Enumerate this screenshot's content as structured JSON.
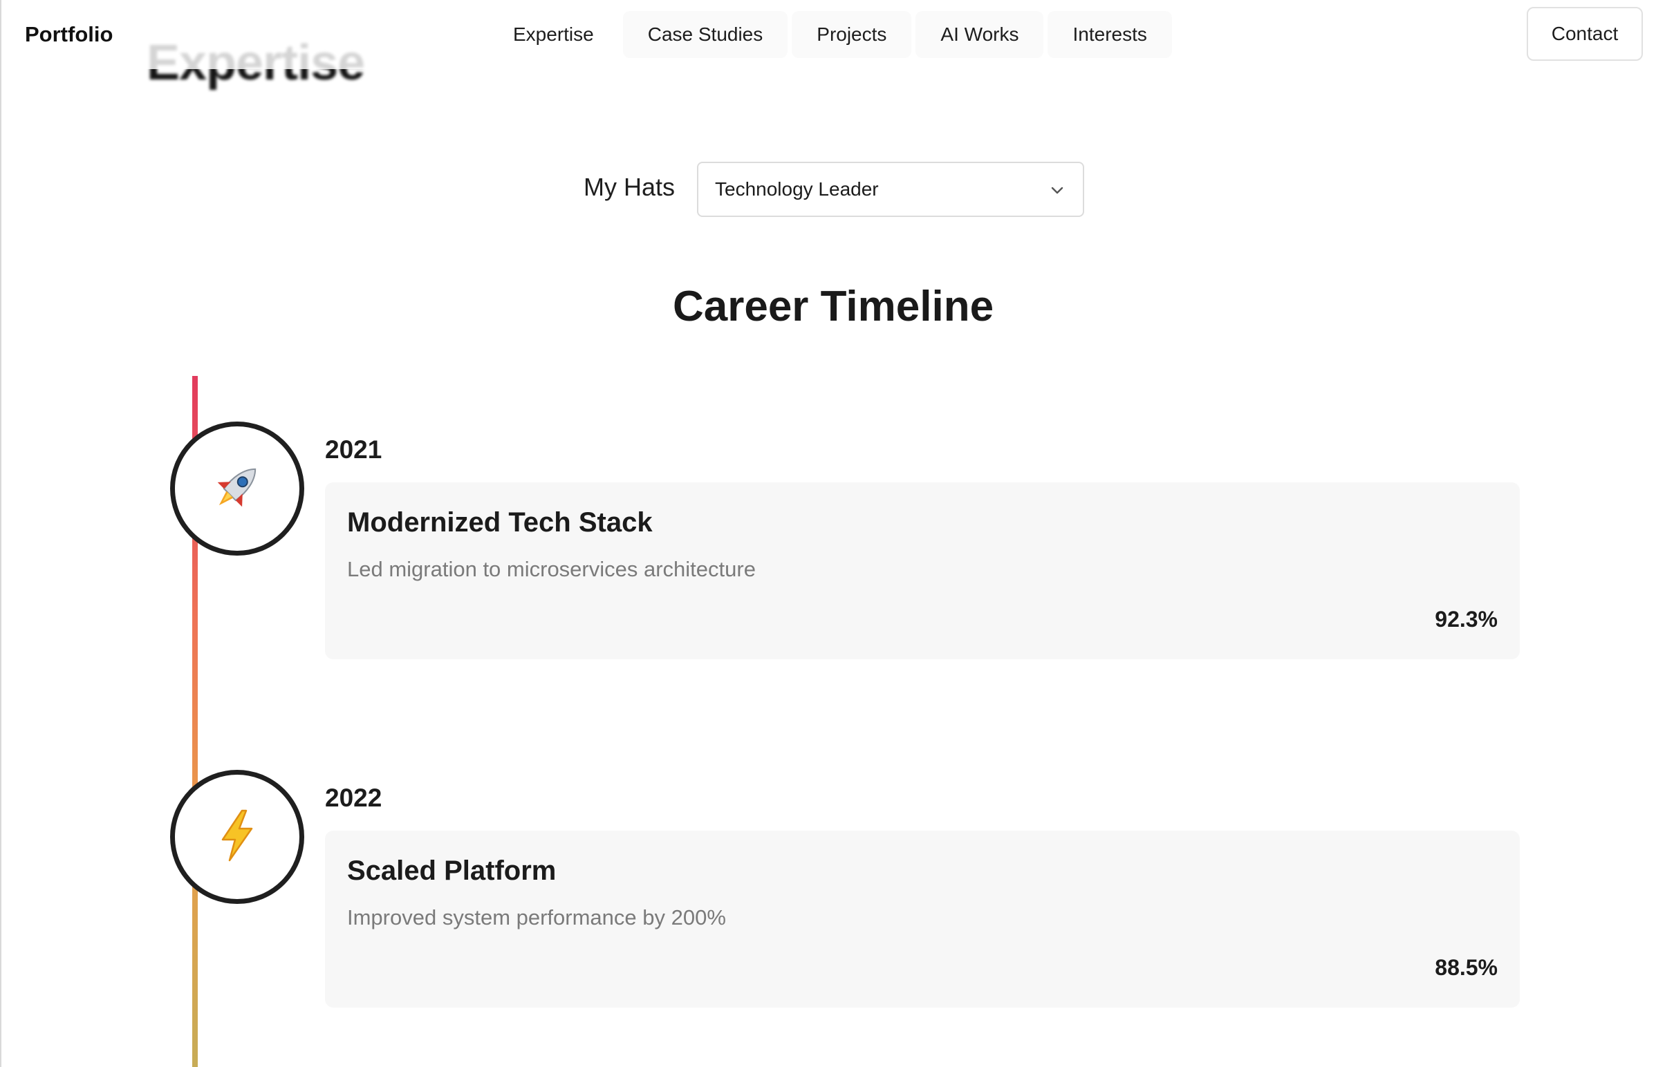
{
  "page": {
    "section_heading": "Expertise"
  },
  "navbar": {
    "brand": "Portfolio",
    "items": [
      {
        "label": "Expertise"
      },
      {
        "label": "Case Studies"
      },
      {
        "label": "Projects"
      },
      {
        "label": "AI Works"
      },
      {
        "label": "Interests"
      }
    ],
    "contact_label": "Contact"
  },
  "hats": {
    "label": "My Hats",
    "selected": "Technology Leader"
  },
  "timeline": {
    "title": "Career Timeline",
    "entries": [
      {
        "year": "2021",
        "icon": "rocket-icon",
        "title": "Modernized Tech Stack",
        "description": "Led migration to microservices architecture",
        "score": "92.3%"
      },
      {
        "year": "2022",
        "icon": "lightning-icon",
        "title": "Scaled Platform",
        "description": "Improved system performance by 200%",
        "score": "88.5%"
      }
    ]
  },
  "colors": {
    "timeline_top": "#e23b5d",
    "timeline_mid": "#ee7356",
    "timeline_bottom": "#c7ac57",
    "card_bg": "#f7f7f7",
    "muted_text": "#7a7a7a"
  }
}
